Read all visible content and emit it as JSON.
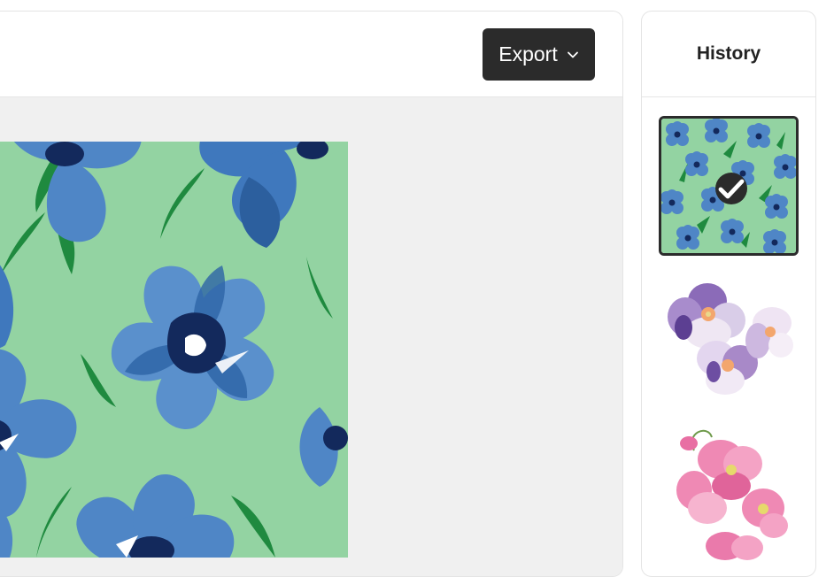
{
  "toolbar": {
    "export_label": "Export",
    "export_icon": "chevron-down-icon"
  },
  "canvas": {
    "artwork": "blue-floral-pattern"
  },
  "history": {
    "title": "History",
    "items": [
      {
        "name": "blue-floral-pattern",
        "selected": true,
        "badge_icon": "check-icon"
      },
      {
        "name": "purple-watercolor-pansies",
        "selected": false
      },
      {
        "name": "pink-sweet-pea-flowers",
        "selected": false
      }
    ]
  },
  "colors": {
    "accent_dark": "#2b2b2b",
    "canvas_bg": "#f0f0f0",
    "pattern_bg": "#93d3a2",
    "flower_blue": "#4f86c6",
    "flower_navy": "#13295c"
  }
}
